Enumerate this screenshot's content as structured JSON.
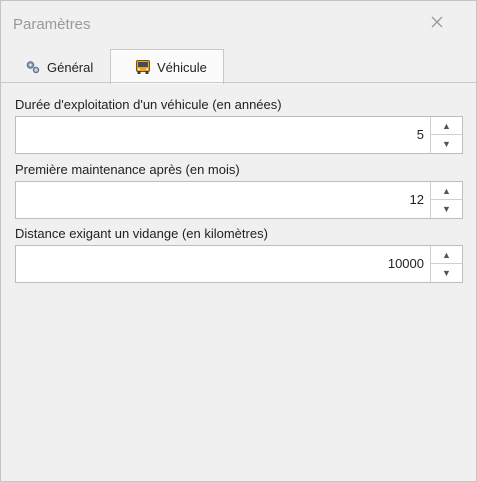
{
  "window": {
    "title": "Paramètres"
  },
  "tabs": [
    {
      "label": "Général",
      "icon": "gears-icon"
    },
    {
      "label": "Véhicule",
      "icon": "vehicle-icon"
    }
  ],
  "fields": [
    {
      "label": "Durée d'exploitation d'un véhicule (en années)",
      "value": "5"
    },
    {
      "label": "Première maintenance après (en mois)",
      "value": "12"
    },
    {
      "label": "Distance exigant un vidange (en kilomètres)",
      "value": "10000"
    }
  ],
  "icons": {
    "close": "close-icon",
    "up": "chevron-up-icon",
    "down": "chevron-down-icon"
  }
}
